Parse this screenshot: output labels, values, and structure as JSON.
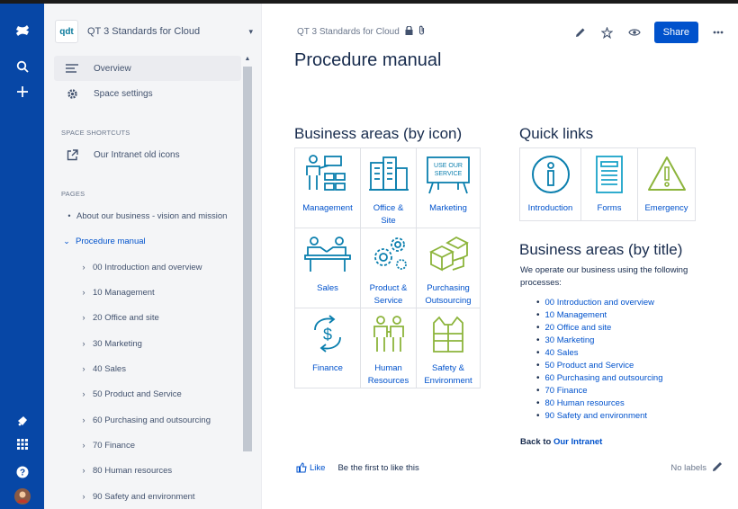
{
  "colors": {
    "global_nav": "#0747a6",
    "link": "#0052cc",
    "icon_teal": "#0b7fae",
    "icon_green": "#8cb43b"
  },
  "global_nav": {
    "icons": [
      "confluence-logo-icon",
      "search-icon",
      "create-icon",
      "notification-icon",
      "app-switcher-icon",
      "help-icon",
      "profile-avatar"
    ]
  },
  "sidebar": {
    "space_logo": "qdt",
    "space_name": "QT 3 Standards for Cloud",
    "overview": "Overview",
    "space_settings": "Space settings",
    "shortcuts_heading": "SPACE SHORTCUTS",
    "shortcut_1": "Our Intranet old icons",
    "pages_heading": "PAGES",
    "tree": [
      "About our business - vision and mission",
      "Procedure manual",
      "00 Introduction and overview",
      "10 Management",
      "20 Office and site",
      "30 Marketing",
      "40 Sales",
      "50 Product and Service",
      "60 Purchasing and outsourcing",
      "70 Finance",
      "80 Human resources",
      "90 Safety and environment"
    ]
  },
  "header": {
    "breadcrumb": "QT 3 Standards for Cloud",
    "share": "Share"
  },
  "page": {
    "title": "Procedure manual",
    "icon_section_heading": "Business areas (by icon)",
    "icon_tiles": [
      [
        "Management"
      ],
      [
        "Office &",
        "Site"
      ],
      [
        "Marketing"
      ],
      [
        "Sales"
      ],
      [
        "Product &",
        "Service"
      ],
      [
        "Purchasing",
        "Outsourcing"
      ],
      [
        "Finance"
      ],
      [
        "Human",
        "Resources"
      ],
      [
        "Safety &",
        "Environment"
      ]
    ],
    "marketing_sign": [
      "USE OUR",
      "SERVICE"
    ],
    "quick_links_heading": "Quick links",
    "quick_links": [
      "Introduction",
      "Forms",
      "Emergency"
    ],
    "title_section_heading": "Business areas (by title)",
    "intro": "We operate our business using the following processes:",
    "process_links": [
      "00 Introduction and overview",
      "10 Management",
      "20 Office and site",
      "30 Marketing",
      "40 Sales",
      "50 Product and Service",
      "60 Purchasing and outsourcing",
      "70 Finance",
      "80 Human resources",
      "90 Safety and environment"
    ],
    "back_to_prefix": "Back to",
    "back_to_link": "Our Intranet",
    "like": "Like",
    "like_prompt": "Be the first to like this",
    "no_labels": "No labels"
  }
}
